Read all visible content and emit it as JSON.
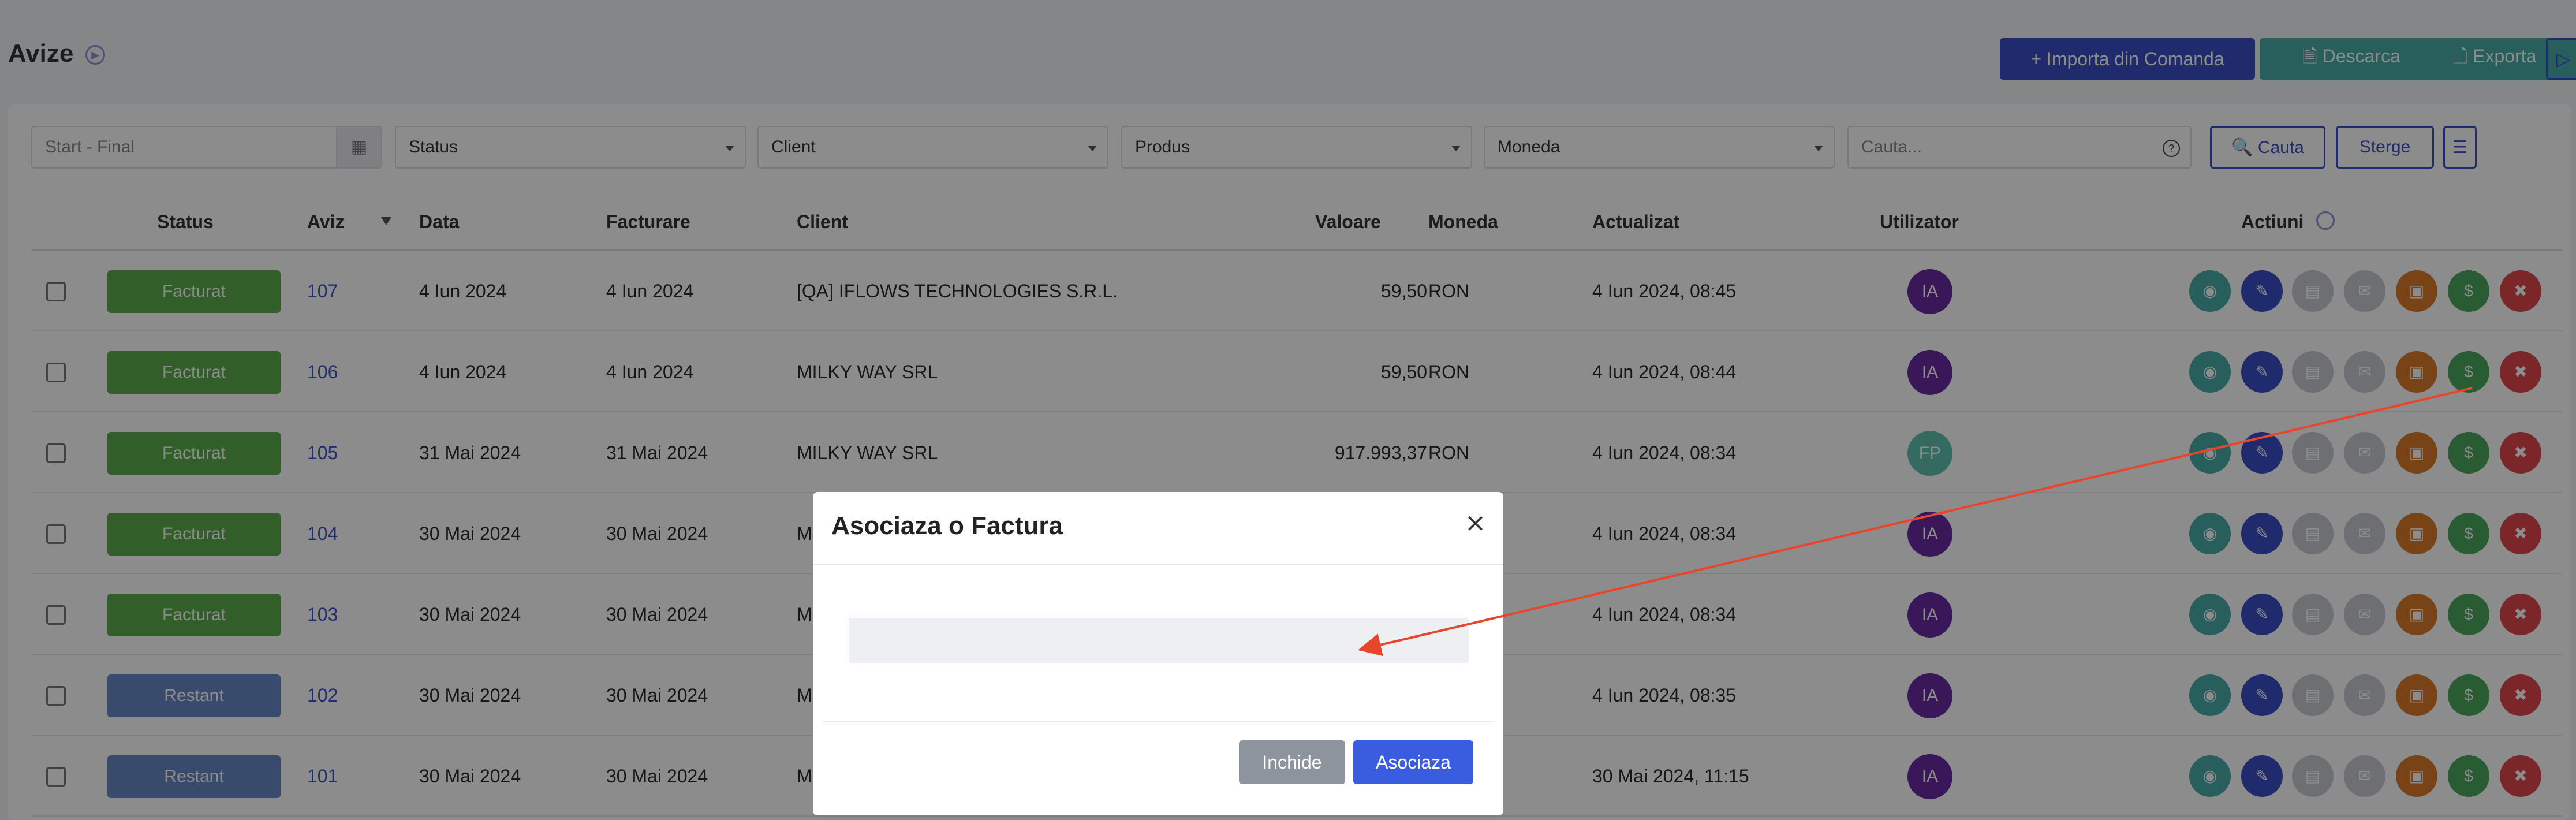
{
  "header": {
    "title": "Avize",
    "buttons": {
      "import": "+ Importa din Comanda",
      "download": "🗎 Descarca",
      "export": "🗋 Exporta"
    }
  },
  "filters": {
    "date_placeholder": "Start - Final",
    "status": "Status",
    "client": "Client",
    "produs": "Produs",
    "moneda": "Moneda",
    "search_placeholder": "Cauta...",
    "btn_search": "🔍 Cauta",
    "btn_clear": "Sterge"
  },
  "table": {
    "headers": {
      "status": "Status",
      "aviz": "Aviz",
      "data": "Data",
      "facturare": "Facturare",
      "client": "Client",
      "valoare": "Valoare",
      "moneda": "Moneda",
      "actualizat": "Actualizat",
      "utilizator": "Utilizator",
      "actiuni": "Actiuni"
    },
    "rows": [
      {
        "status": "Facturat",
        "aviz": "107",
        "data": "4 Iun 2024",
        "facturare": "4 Iun 2024",
        "client": "[QA] IFLOWS TECHNOLOGIES S.R.L.",
        "valoare": "59,50",
        "moneda": "RON",
        "actualizat": "4 Iun 2024, 08:45",
        "user": "IA"
      },
      {
        "status": "Facturat",
        "aviz": "106",
        "data": "4 Iun 2024",
        "facturare": "4 Iun 2024",
        "client": "MILKY WAY SRL",
        "valoare": "59,50",
        "moneda": "RON",
        "actualizat": "4 Iun 2024, 08:44",
        "user": "IA"
      },
      {
        "status": "Facturat",
        "aviz": "105",
        "data": "31 Mai 2024",
        "facturare": "31 Mai 2024",
        "client": "MILKY WAY SRL",
        "valoare": "917.993,37",
        "moneda": "RON",
        "actualizat": "4 Iun 2024, 08:34",
        "user": "FP"
      },
      {
        "status": "Facturat",
        "aviz": "104",
        "data": "30 Mai 2024",
        "facturare": "30 Mai 2024",
        "client": "M",
        "valoare": "",
        "moneda": "",
        "actualizat": "4 Iun 2024, 08:34",
        "user": "IA"
      },
      {
        "status": "Facturat",
        "aviz": "103",
        "data": "30 Mai 2024",
        "facturare": "30 Mai 2024",
        "client": "M",
        "valoare": "",
        "moneda": "",
        "actualizat": "4 Iun 2024, 08:34",
        "user": "IA"
      },
      {
        "status": "Restant",
        "aviz": "102",
        "data": "30 Mai 2024",
        "facturare": "30 Mai 2024",
        "client": "M",
        "valoare": "",
        "moneda": "",
        "actualizat": "4 Iun 2024, 08:35",
        "user": "IA"
      },
      {
        "status": "Restant",
        "aviz": "101",
        "data": "30 Mai 2024",
        "facturare": "30 Mai 2024",
        "client": "M",
        "valoare": "",
        "moneda": "",
        "actualizat": "30 Mai 2024, 11:15",
        "user": "IA"
      }
    ]
  },
  "modal": {
    "title": "Asociaza o Factura",
    "close_symbol": "×",
    "btn_close": "Inchide",
    "btn_associate": "Asociaza"
  },
  "colors": {
    "primary": "#3a4fc6",
    "teal": "#4aaeaa",
    "facturat": "#5aab4c",
    "restant": "#6689c6",
    "avatar_ia": "#6a2aa0",
    "avatar_fp": "#5fc2b0",
    "annotation_arrow": "#e8452c"
  },
  "icons": [
    "play-circle-icon",
    "calendar-icon",
    "question-icon",
    "search-icon",
    "filter-icon",
    "eye-icon",
    "pencil-icon",
    "document-icon",
    "mail-icon",
    "file-icon",
    "dollar-icon",
    "trash-icon"
  ]
}
